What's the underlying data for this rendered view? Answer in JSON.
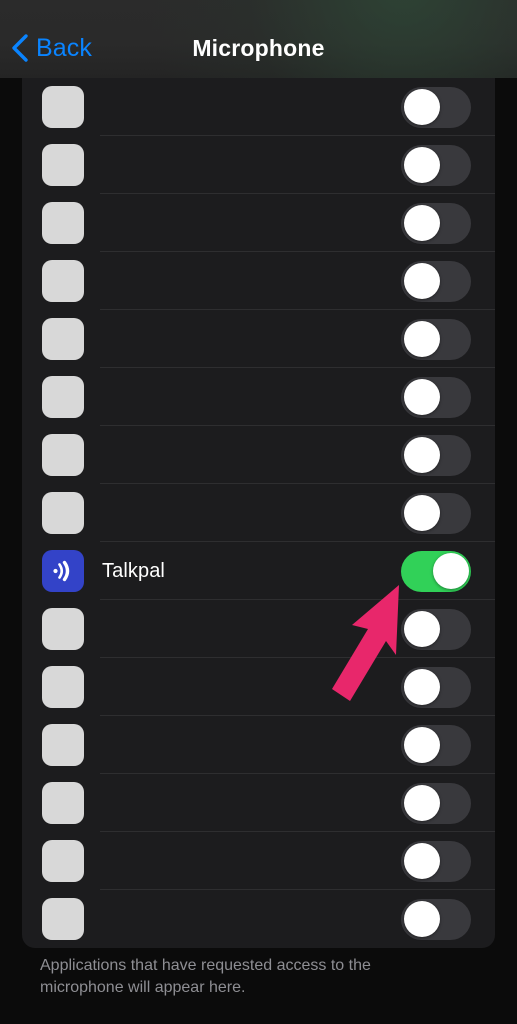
{
  "header": {
    "back_label": "Back",
    "back_icon": "chevron-left-icon",
    "title": "Microphone",
    "accent_color": "#0a84ff"
  },
  "list": {
    "rows": [
      {
        "label": "",
        "icon": "placeholder-app-icon",
        "enabled": false,
        "placeholder": true
      },
      {
        "label": "",
        "icon": "placeholder-app-icon",
        "enabled": false,
        "placeholder": true
      },
      {
        "label": "",
        "icon": "placeholder-app-icon",
        "enabled": false,
        "placeholder": true
      },
      {
        "label": "",
        "icon": "placeholder-app-icon",
        "enabled": false,
        "placeholder": true
      },
      {
        "label": "",
        "icon": "placeholder-app-icon",
        "enabled": false,
        "placeholder": true
      },
      {
        "label": "",
        "icon": "placeholder-app-icon",
        "enabled": false,
        "placeholder": true
      },
      {
        "label": "",
        "icon": "placeholder-app-icon",
        "enabled": false,
        "placeholder": true
      },
      {
        "label": "",
        "icon": "placeholder-app-icon",
        "enabled": false,
        "placeholder": true
      },
      {
        "label": "Talkpal",
        "icon": "talkpal-app-icon",
        "enabled": true,
        "placeholder": false
      },
      {
        "label": "",
        "icon": "placeholder-app-icon",
        "enabled": false,
        "placeholder": true
      },
      {
        "label": "",
        "icon": "placeholder-app-icon",
        "enabled": false,
        "placeholder": true
      },
      {
        "label": "",
        "icon": "placeholder-app-icon",
        "enabled": false,
        "placeholder": true
      },
      {
        "label": "",
        "icon": "placeholder-app-icon",
        "enabled": false,
        "placeholder": true
      },
      {
        "label": "",
        "icon": "placeholder-app-icon",
        "enabled": false,
        "placeholder": true
      },
      {
        "label": "",
        "icon": "placeholder-app-icon",
        "enabled": false,
        "placeholder": true
      }
    ],
    "toggle_on_color": "#31d158",
    "toggle_off_color": "#39393d",
    "panel_color": "#1c1c1e"
  },
  "footer": {
    "note": "Applications that have requested access to the microphone will appear here."
  },
  "annotation": {
    "type": "arrow",
    "color": "#e8276b",
    "points_to": "talkpal-microphone-toggle"
  }
}
